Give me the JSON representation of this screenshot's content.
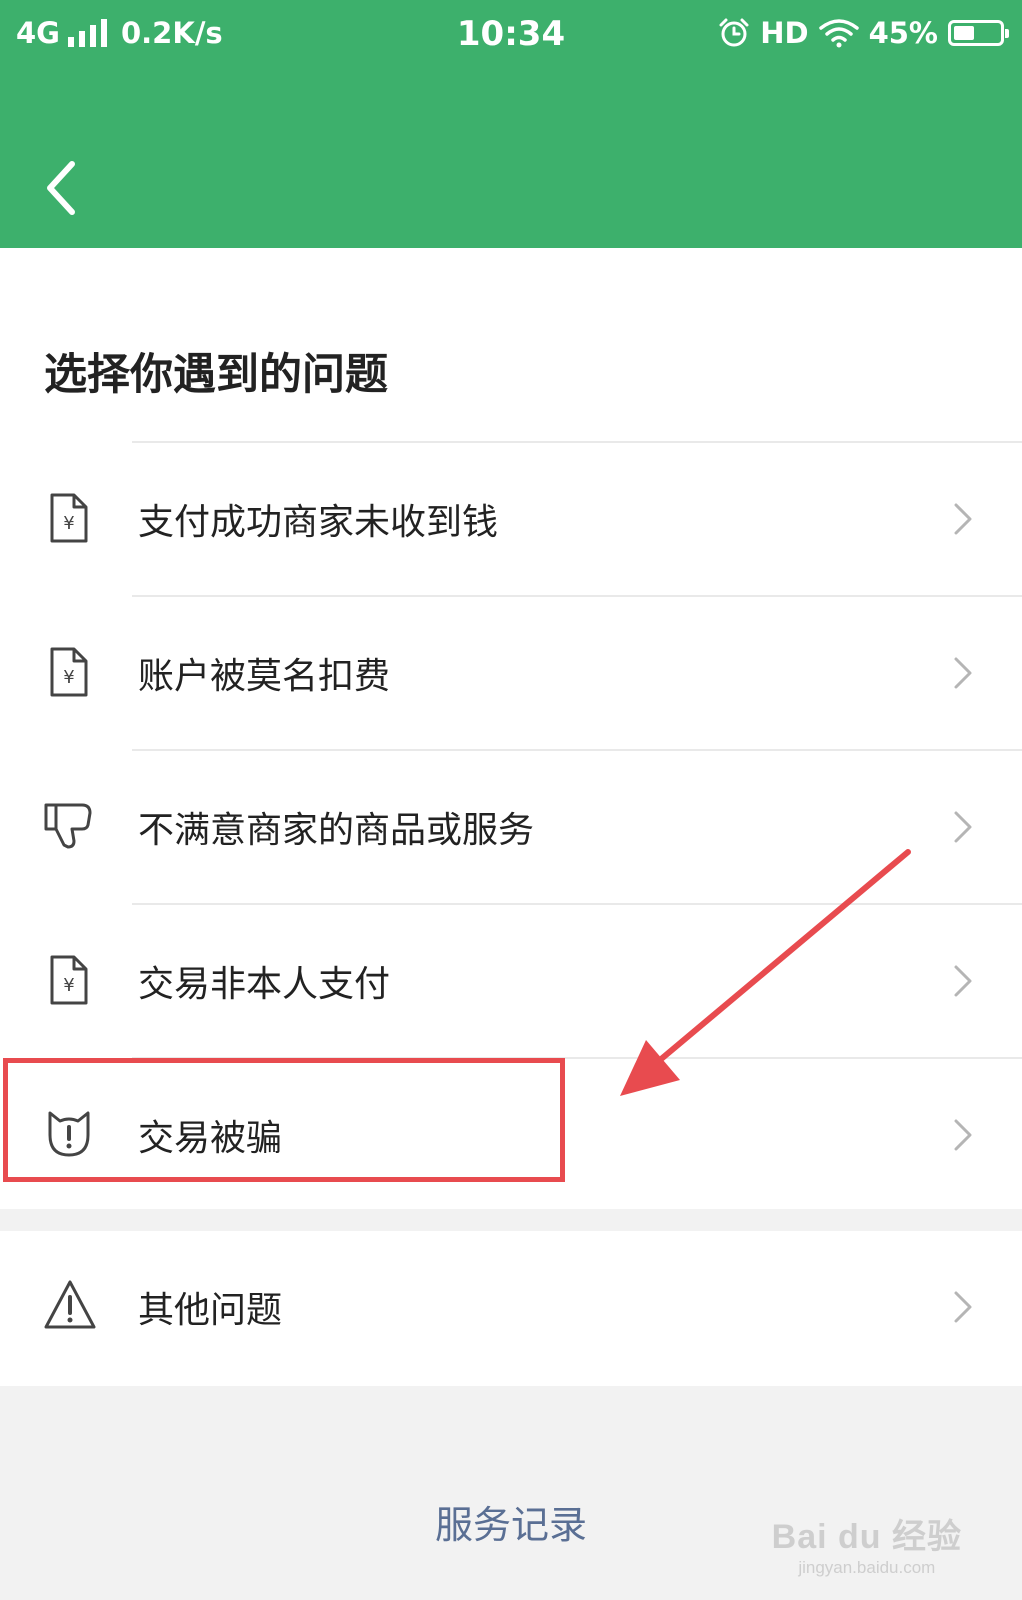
{
  "status_bar": {
    "network": "4G",
    "speed": "0.2K/s",
    "time": "10:34",
    "hd": "HD",
    "battery": "45%",
    "battery_level": 0.45,
    "icons": [
      "signal-icon",
      "alarm-icon",
      "wifi-icon",
      "battery-icon"
    ]
  },
  "header": {
    "background_color": "#3db06c",
    "back_icon": "chevron-left-icon"
  },
  "page": {
    "title": "选择你遇到的问题"
  },
  "problems": [
    {
      "label": "支付成功商家未收到钱",
      "icon": "yuan-document-icon"
    },
    {
      "label": "账户被莫名扣费",
      "icon": "yuan-document-icon"
    },
    {
      "label": "不满意商家的商品或服务",
      "icon": "thumbs-down-icon"
    },
    {
      "label": "交易非本人支付",
      "icon": "yuan-document-icon"
    },
    {
      "label": "交易被骗",
      "icon": "alert-cat-icon"
    }
  ],
  "other": {
    "label": "其他问题",
    "icon": "warning-triangle-icon"
  },
  "footer": {
    "service_record": "服务记录",
    "link_color": "#5a6f94"
  },
  "watermark": {
    "brand": "Bai du 经验",
    "site": "jingyan.baidu.com"
  },
  "annotation": {
    "color": "#e84b4f",
    "highlights": "交易被骗"
  }
}
